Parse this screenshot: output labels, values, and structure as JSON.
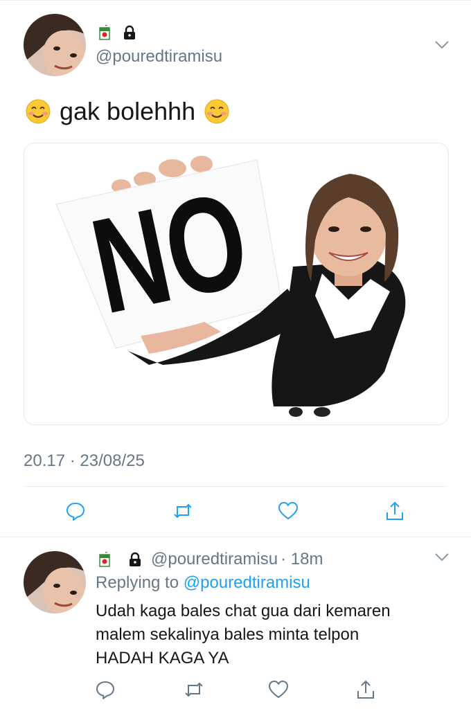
{
  "tweet": {
    "handle": "@pouredtiramisu",
    "text": "gak bolehhh",
    "timestamp": "20.17 · 23/08/25",
    "image": {
      "card_text": "NO"
    }
  },
  "reply": {
    "handle": "@pouredtiramisu",
    "time": "· 18m",
    "replying_prefix": "Replying to",
    "replying_handle": "@pouredtiramisu",
    "text_lines": [
      "Udah kaga bales chat gua dari kemaren",
      "malem sekalinya bales minta telpon",
      "HADAH KAGA YA"
    ]
  },
  "icons": {
    "profile_badge": "juice-box-icon",
    "protected": "lock-icon",
    "more": "chevron-down-icon",
    "emoji": "smiling-face-icon",
    "reply": "comment-icon",
    "retweet": "retweet-icon",
    "like": "heart-icon",
    "share": "share-icon"
  },
  "colors": {
    "link": "#1da1f2",
    "secondary_text": "#657786",
    "divider": "#e6ecf0"
  }
}
